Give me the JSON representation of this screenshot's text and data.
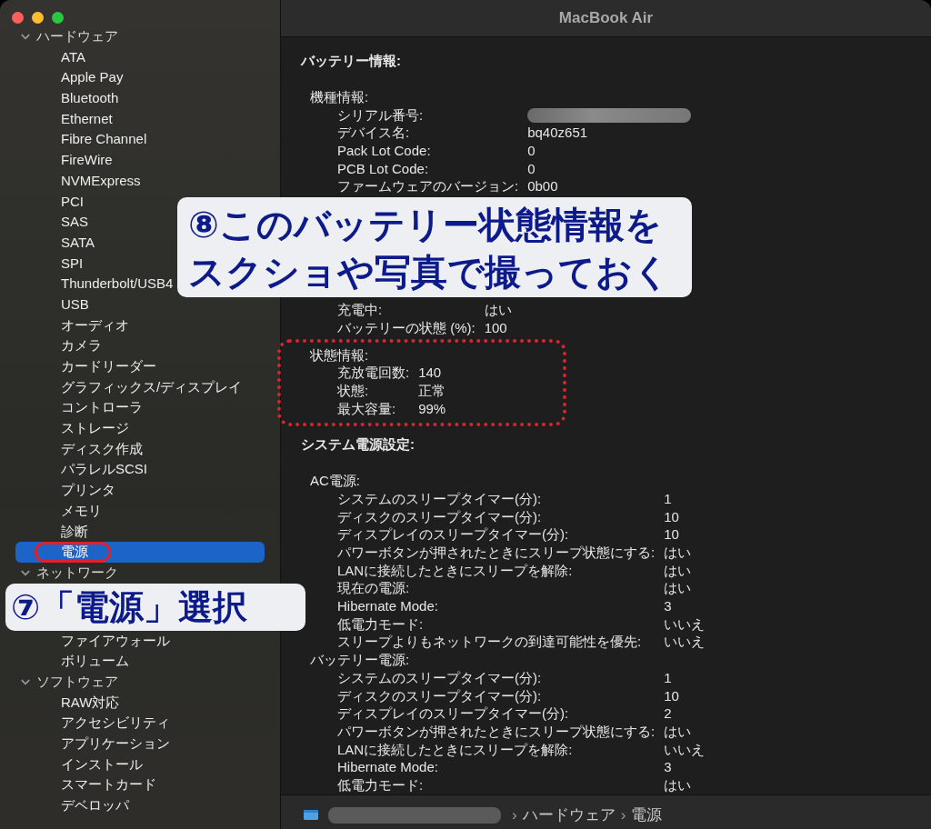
{
  "window": {
    "title": "MacBook Air"
  },
  "sidebar": {
    "groups": [
      {
        "label": "ハードウェア",
        "expanded": true,
        "children": [
          {
            "label": "ATA",
            "selected": false
          },
          {
            "label": "Apple Pay",
            "selected": false
          },
          {
            "label": "Bluetooth",
            "selected": false
          },
          {
            "label": "Ethernet",
            "selected": false
          },
          {
            "label": "Fibre Channel",
            "selected": false
          },
          {
            "label": "FireWire",
            "selected": false
          },
          {
            "label": "NVMExpress",
            "selected": false
          },
          {
            "label": "PCI",
            "selected": false
          },
          {
            "label": "SAS",
            "selected": false
          },
          {
            "label": "SATA",
            "selected": false
          },
          {
            "label": "SPI",
            "selected": false
          },
          {
            "label": "Thunderbolt/USB4",
            "selected": false
          },
          {
            "label": "USB",
            "selected": false
          },
          {
            "label": "オーディオ",
            "selected": false
          },
          {
            "label": "カメラ",
            "selected": false
          },
          {
            "label": "カードリーダー",
            "selected": false
          },
          {
            "label": "グラフィックス/ディスプレイ",
            "selected": false
          },
          {
            "label": "コントローラ",
            "selected": false
          },
          {
            "label": "ストレージ",
            "selected": false
          },
          {
            "label": "ディスク作成",
            "selected": false
          },
          {
            "label": "パラレルSCSI",
            "selected": false
          },
          {
            "label": "プリンタ",
            "selected": false
          },
          {
            "label": "メモリ",
            "selected": false
          },
          {
            "label": "診断",
            "selected": false
          },
          {
            "label": "電源",
            "selected": true,
            "circled": true
          }
        ]
      },
      {
        "label": "ネットワーク",
        "expanded": true,
        "callout": "⑦「電源」選択",
        "children": [
          {
            "label": "ファイアウォール",
            "selected": false
          },
          {
            "label": "ボリューム",
            "selected": false
          }
        ]
      },
      {
        "label": "ソフトウェア",
        "expanded": true,
        "children": [
          {
            "label": "RAW対応",
            "selected": false
          },
          {
            "label": "アクセシビリティ",
            "selected": false
          },
          {
            "label": "アプリケーション",
            "selected": false
          },
          {
            "label": "インストール",
            "selected": false
          },
          {
            "label": "スマートカード",
            "selected": false
          },
          {
            "label": "デベロッパ",
            "selected": false
          }
        ]
      }
    ]
  },
  "content": {
    "blocks": [
      {
        "kind": "heading",
        "text": "バッテリー情報:"
      },
      {
        "kind": "section",
        "title": "機種情報:",
        "rows": [
          {
            "label": "シリアル番号:",
            "redacted": true
          },
          {
            "label": "デバイス名:",
            "value": "bq40z651"
          },
          {
            "label": "Pack Lot Code:",
            "value": "0"
          },
          {
            "label": "PCB Lot Code:",
            "value": "0"
          },
          {
            "label": "ファームウェアのバージョン:",
            "value": "0b00"
          }
        ]
      },
      {
        "kind": "callout",
        "lines": [
          "⑧このバッテリー状態情報を",
          "スクショや写真で撮っておく"
        ]
      },
      {
        "kind": "section",
        "rows": [
          {
            "label": "充電中:",
            "value": "はい"
          },
          {
            "label": "バッテリーの状態 (%):",
            "value": "100"
          }
        ]
      },
      {
        "kind": "section",
        "title": "状態情報:",
        "framed": true,
        "rows": [
          {
            "label": "充放電回数:",
            "value": "140"
          },
          {
            "label": "状態:",
            "value": "正常"
          },
          {
            "label": "最大容量:",
            "value": "99%"
          }
        ]
      },
      {
        "kind": "heading",
        "text": "システム電源設定:"
      },
      {
        "kind": "section",
        "title": "AC電源:",
        "rows": [
          {
            "label": "システムのスリープタイマー(分):",
            "value": "1"
          },
          {
            "label": "ディスクのスリープタイマー(分):",
            "value": "10"
          },
          {
            "label": "ディスプレイのスリープタイマー(分):",
            "value": "10"
          },
          {
            "label": "パワーボタンが押されたときにスリープ状態にする:",
            "value": "はい"
          },
          {
            "label": "LANに接続したときにスリープを解除:",
            "value": "はい"
          },
          {
            "label": "現在の電源:",
            "value": "はい"
          },
          {
            "label": "Hibernate Mode:",
            "value": "3"
          },
          {
            "label": "低電力モード:",
            "value": "いいえ"
          },
          {
            "label": "スリープよりもネットワークの到達可能性を優先:",
            "value": "いいえ"
          }
        ]
      },
      {
        "kind": "section",
        "title": "バッテリー電源:",
        "rows": [
          {
            "label": "システムのスリープタイマー(分):",
            "value": "1"
          },
          {
            "label": "ディスクのスリープタイマー(分):",
            "value": "10"
          },
          {
            "label": "ディスプレイのスリープタイマー(分):",
            "value": "2"
          },
          {
            "label": "パワーボタンが押されたときにスリープ状態にする:",
            "value": "はい"
          },
          {
            "label": "LANに接続したときにスリープを解除:",
            "value": "いいえ"
          },
          {
            "label": "Hibernate Mode:",
            "value": "3"
          },
          {
            "label": "低電力モード:",
            "value": "はい"
          }
        ]
      }
    ]
  },
  "path_bar": {
    "crumbs": [
      {
        "sep": "›",
        "label": "ハードウェア"
      },
      {
        "sep": "›",
        "label": "電源"
      }
    ]
  }
}
